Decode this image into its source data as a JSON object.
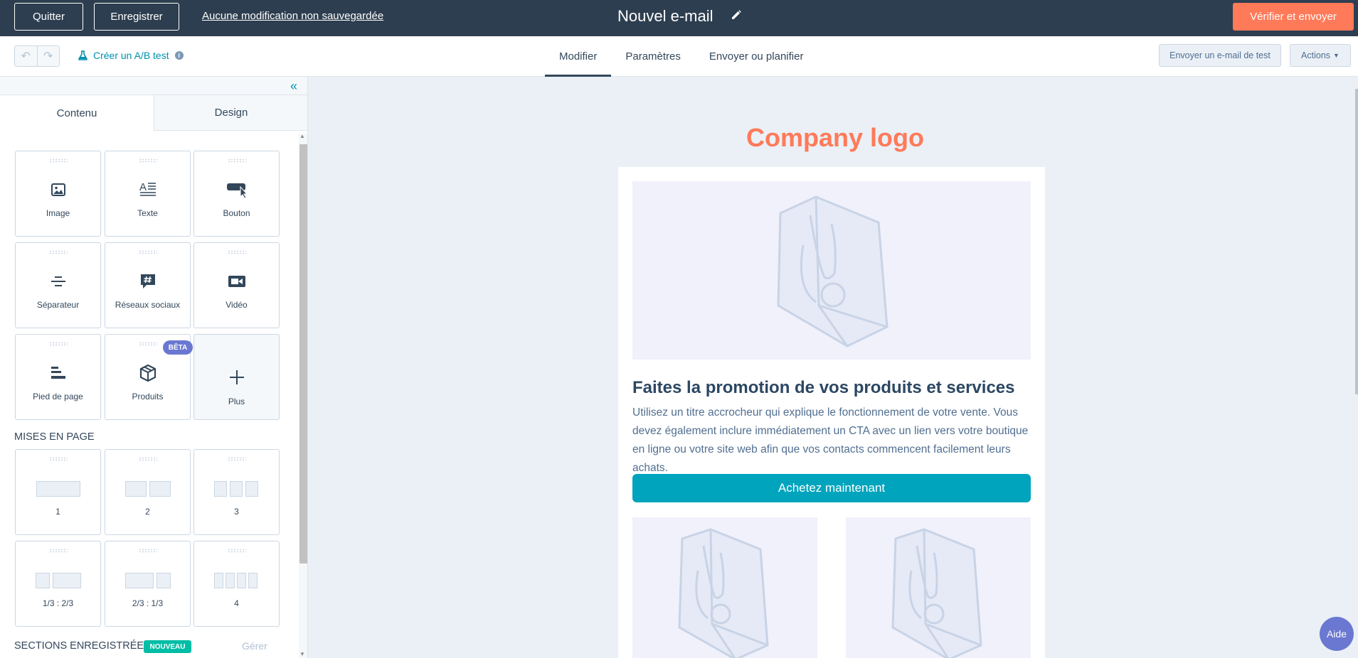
{
  "topbar": {
    "quit_label": "Quitter",
    "save_label": "Enregistrer",
    "unsaved_text": "Aucune modification non sauvegardée",
    "title": "Nouvel e-mail",
    "verify_label": "Vérifier et envoyer"
  },
  "toolbar": {
    "ab_test_label": "Créer un A/B test",
    "tabs": [
      {
        "label": "Modifier",
        "active": true
      },
      {
        "label": "Paramètres",
        "active": false
      },
      {
        "label": "Envoyer ou planifier",
        "active": false
      }
    ],
    "test_email_label": "Envoyer un e-mail de test",
    "actions_label": "Actions"
  },
  "sidebar": {
    "tabs": [
      {
        "label": "Contenu",
        "active": true
      },
      {
        "label": "Design",
        "active": false
      }
    ],
    "modules": [
      {
        "label": "Image",
        "icon": "image-icon"
      },
      {
        "label": "Texte",
        "icon": "text-icon"
      },
      {
        "label": "Bouton",
        "icon": "button-icon"
      },
      {
        "label": "Séparateur",
        "icon": "divider-icon"
      },
      {
        "label": "Réseaux sociaux",
        "icon": "social-icon"
      },
      {
        "label": "Vidéo",
        "icon": "video-icon"
      },
      {
        "label": "Pied de page",
        "icon": "footer-icon"
      },
      {
        "label": "Produits",
        "icon": "products-icon"
      },
      {
        "label": "Plus",
        "icon": "plus-icon"
      }
    ],
    "beta_badge": "BÊTA",
    "layouts_title": "MISES EN PAGE",
    "layouts": [
      {
        "label": "1"
      },
      {
        "label": "2"
      },
      {
        "label": "3"
      },
      {
        "label": "1/3 : 2/3"
      },
      {
        "label": "2/3 : 1/3"
      },
      {
        "label": "4"
      }
    ],
    "saved_sections_title": "SECTIONS ENREGISTRÉES",
    "new_badge": "NOUVEAU",
    "manage_label": "Gérer"
  },
  "email": {
    "logo_text": "Company logo",
    "headline": "Faites la promotion de vos produits et services",
    "body_text": "Utilisez un titre accrocheur qui explique le fonctionnement de votre vente. Vous devez également inclure immédiatement un CTA avec un lien vers votre boutique en ligne ou votre site web afin que vos contacts commencent facilement leurs achats.",
    "cta_label": "Achetez maintenant"
  },
  "help_label": "Aide",
  "colors": {
    "topbar": "#2d3e50",
    "accent_orange": "#ff7a59",
    "link_teal": "#0091ae",
    "cta": "#00a4bd",
    "beta": "#6a78d1",
    "new": "#00bda5"
  }
}
